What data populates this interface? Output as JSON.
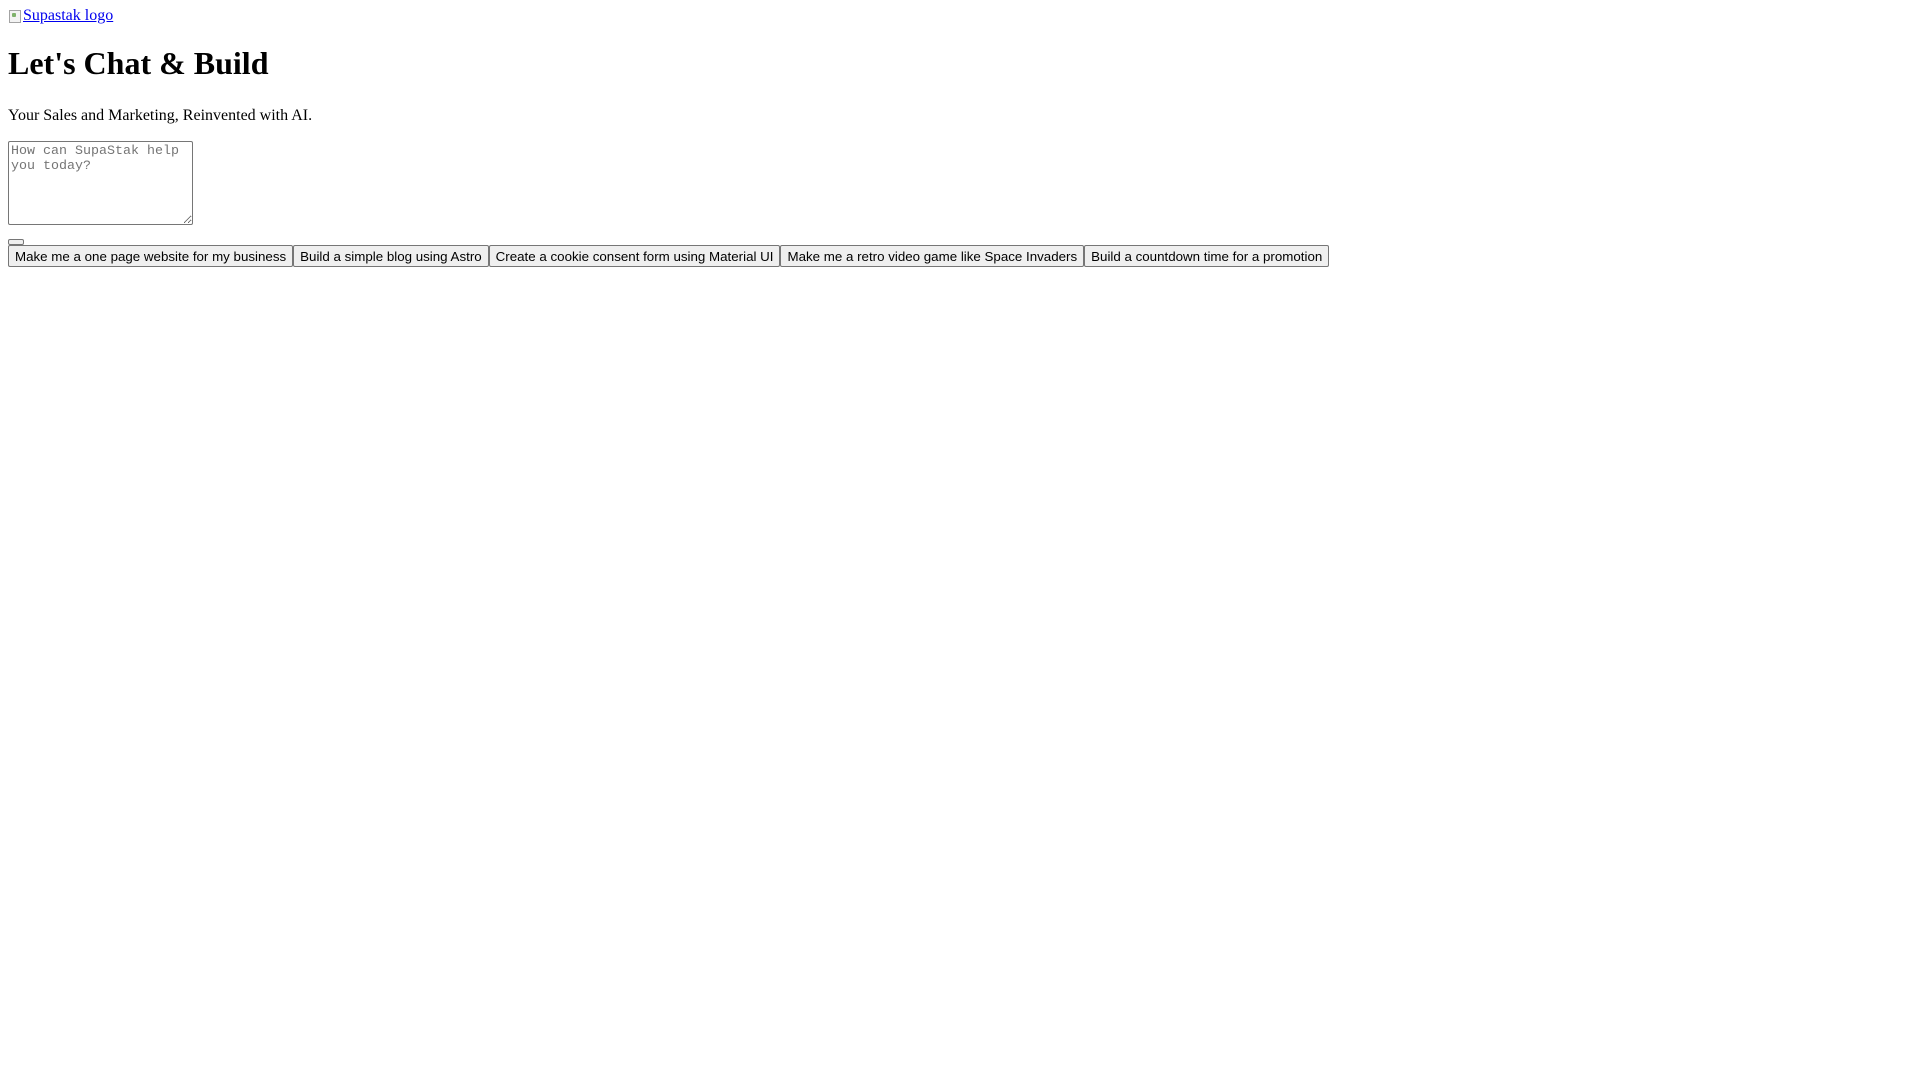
{
  "header": {
    "logo_alt": "Supastak logo"
  },
  "hero": {
    "title": "Let's Chat & Build",
    "subtitle": "Your Sales and Marketing, Reinvented with AI."
  },
  "prompt": {
    "placeholder": "How can SupaStak help you today?",
    "value": ""
  },
  "suggestions": [
    {
      "label": "Make me a one page website for my business"
    },
    {
      "label": "Build a simple blog using Astro"
    },
    {
      "label": "Create a cookie consent form using Material UI"
    },
    {
      "label": "Make me a retro video game like Space Invaders"
    },
    {
      "label": "Build a countdown time for a promotion"
    }
  ],
  "colors": {
    "link": "#0000ee",
    "button_bg": "#efefef",
    "button_border": "#767676"
  }
}
